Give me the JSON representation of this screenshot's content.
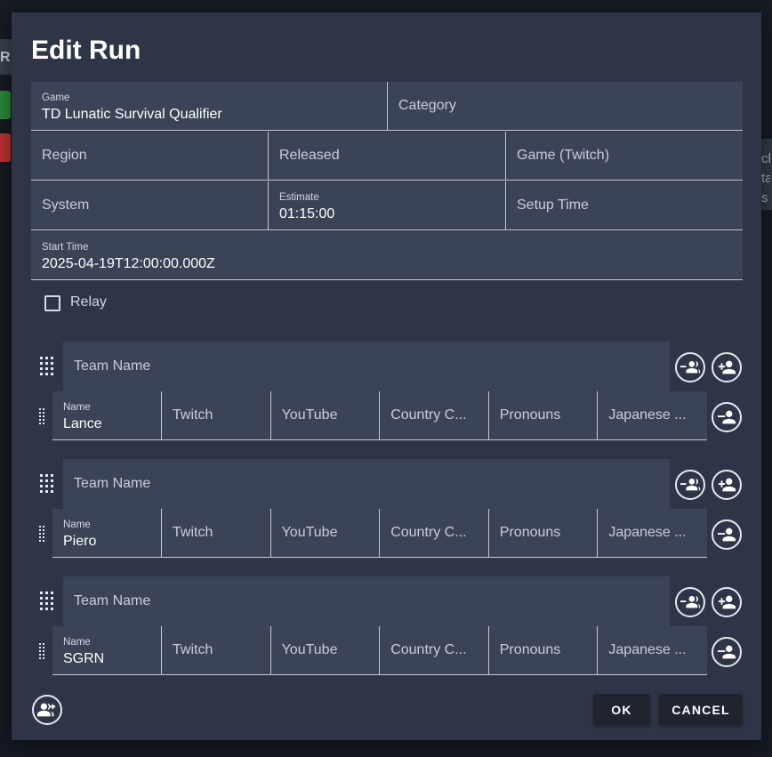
{
  "background": {
    "left_letter": "R",
    "right_text": [
      "ch",
      "ta",
      "s"
    ]
  },
  "dialog": {
    "title": "Edit Run",
    "fields": {
      "game": {
        "label": "Game",
        "value": "TD Lunatic Survival Qualifier"
      },
      "category": {
        "placeholder": "Category"
      },
      "region": {
        "placeholder": "Region"
      },
      "released": {
        "placeholder": "Released"
      },
      "game_twitch": {
        "placeholder": "Game (Twitch)"
      },
      "system": {
        "placeholder": "System"
      },
      "estimate": {
        "label": "Estimate",
        "value": "01:15:00"
      },
      "setup_time": {
        "placeholder": "Setup Time"
      },
      "start_time": {
        "label": "Start Time",
        "value": "2025-04-19T12:00:00.000Z"
      }
    },
    "relay": {
      "label": "Relay",
      "checked": false
    },
    "teams": [
      {
        "team_name_placeholder": "Team Name",
        "runner": {
          "name_label": "Name",
          "name": "Lance",
          "twitch": "Twitch",
          "youtube": "YouTube",
          "country": "Country C...",
          "pronouns": "Pronouns",
          "japanese": "Japanese ..."
        }
      },
      {
        "team_name_placeholder": "Team Name",
        "runner": {
          "name_label": "Name",
          "name": "Piero",
          "twitch": "Twitch",
          "youtube": "YouTube",
          "country": "Country C...",
          "pronouns": "Pronouns",
          "japanese": "Japanese ..."
        }
      },
      {
        "team_name_placeholder": "Team Name",
        "runner": {
          "name_label": "Name",
          "name": "SGRN",
          "twitch": "Twitch",
          "youtube": "YouTube",
          "country": "Country C...",
          "pronouns": "Pronouns",
          "japanese": "Japanese ..."
        }
      }
    ],
    "buttons": {
      "ok": "OK",
      "cancel": "CANCEL"
    },
    "icons": {
      "remove_team": "group-remove-icon",
      "add_runner": "person-add-icon",
      "remove_runner": "person-remove-icon",
      "add_team": "group-add-icon"
    }
  }
}
